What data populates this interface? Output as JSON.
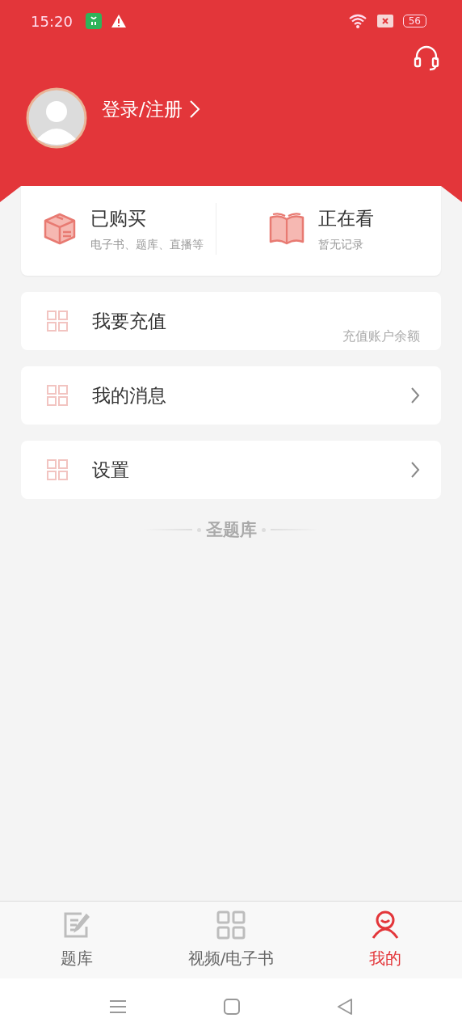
{
  "status_bar": {
    "time": "15:20",
    "battery": "56"
  },
  "profile": {
    "login": "登录/注册"
  },
  "summary": [
    {
      "kind": "purchased",
      "title": "已购买",
      "subtitle": "电子书、题库、直播等"
    },
    {
      "kind": "reading",
      "title": "正在看",
      "subtitle": "暂无记录"
    }
  ],
  "menu": [
    {
      "label": "我要充值",
      "note": "充值账户余额",
      "chevron": false
    },
    {
      "label": "我的消息",
      "chevron": true
    },
    {
      "label": "设置",
      "chevron": true
    }
  ],
  "footer_brand": "圣题库",
  "tabs": [
    {
      "kind": "edit",
      "label": "题库",
      "selected": false
    },
    {
      "kind": "grid",
      "label": "视频/电子书",
      "selected": false
    },
    {
      "kind": "person",
      "label": "我的",
      "selected": true
    }
  ]
}
